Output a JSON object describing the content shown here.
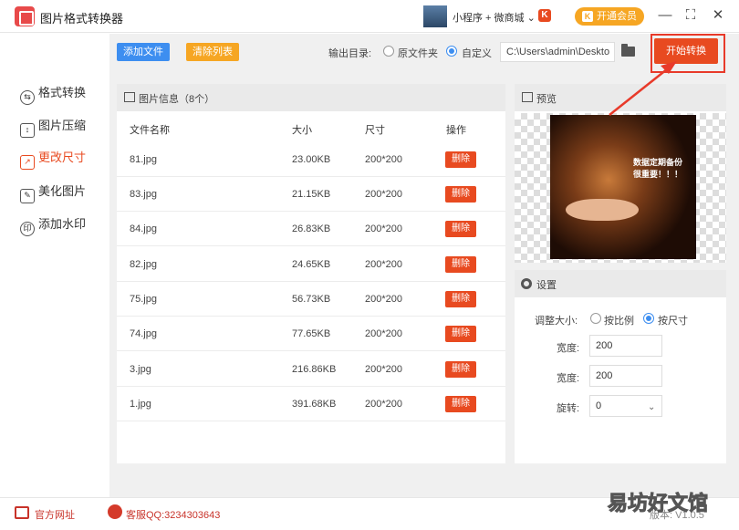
{
  "app": {
    "title": "图片格式转换器"
  },
  "titlebar": {
    "mini_program": "小程序 + 微商城 ⌄",
    "k_badge": "K",
    "vip_label": "开通会员",
    "minimize": "—",
    "maximize": "⛶",
    "close": "✕"
  },
  "sidebar": {
    "items": [
      {
        "label": "格式转换",
        "icon": "swap-icon",
        "active": false
      },
      {
        "label": "图片压缩",
        "icon": "compress-icon",
        "active": false
      },
      {
        "label": "更改尺寸",
        "icon": "resize-icon",
        "active": true
      },
      {
        "label": "美化图片",
        "icon": "beautify-icon",
        "active": false
      },
      {
        "label": "添加水印",
        "icon": "watermark-icon",
        "active": false
      }
    ]
  },
  "toolbar": {
    "add_file": "添加文件",
    "clear_list": "清除列表",
    "output_label": "输出目录:",
    "opt_original": "原文件夹",
    "opt_custom": "自定义",
    "path_value": "C:\\Users\\admin\\Deskto",
    "start": "开始转换"
  },
  "list": {
    "header": "图片信息（8个）",
    "columns": [
      "文件名称",
      "大小",
      "尺寸",
      "操作"
    ],
    "delete_label": "删除",
    "rows": [
      {
        "name": "81.jpg",
        "size": "23.00KB",
        "dim": "200*200"
      },
      {
        "name": "83.jpg",
        "size": "21.15KB",
        "dim": "200*200"
      },
      {
        "name": "84.jpg",
        "size": "26.83KB",
        "dim": "200*200"
      },
      {
        "name": "82.jpg",
        "size": "24.65KB",
        "dim": "200*200"
      },
      {
        "name": "75.jpg",
        "size": "56.73KB",
        "dim": "200*200"
      },
      {
        "name": "74.jpg",
        "size": "77.65KB",
        "dim": "200*200"
      },
      {
        "name": "3.jpg",
        "size": "216.86KB",
        "dim": "200*200"
      },
      {
        "name": "1.jpg",
        "size": "391.68KB",
        "dim": "200*200"
      }
    ]
  },
  "preview": {
    "header": "预览",
    "image_text_1": "数据定期备份",
    "image_text_2": "很重要！！！"
  },
  "settings": {
    "header": "设置",
    "resize_label": "调整大小:",
    "opt_ratio": "按比例",
    "opt_size": "按尺寸",
    "width_label": "宽度:",
    "width_value": "200",
    "height_label": "宽度:",
    "height_value": "200",
    "rotate_label": "旋转:",
    "rotate_value": "0"
  },
  "footer": {
    "website": "官方网址",
    "support": "客服QQ:3234303643",
    "version": "版本: V1.0.5"
  },
  "watermark": {
    "text": "易坊好文馆"
  },
  "colors": {
    "accent": "#e84a20",
    "blue": "#3d8ef0",
    "orange": "#f6a623"
  }
}
